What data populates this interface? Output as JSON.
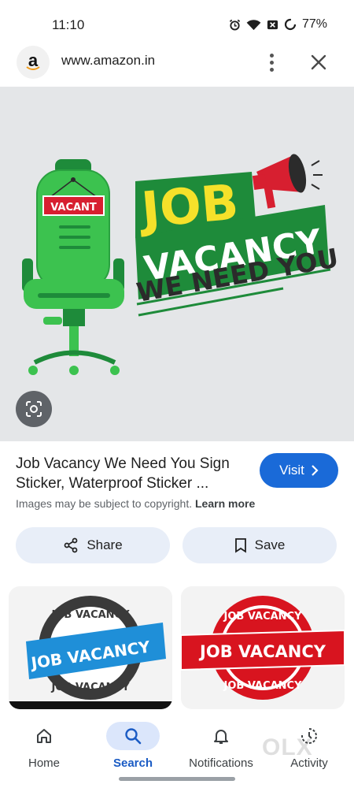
{
  "status_bar": {
    "time": "11:10",
    "battery": "77%",
    "icons": [
      "alarm-icon",
      "wifi-icon",
      "close-box-icon",
      "battery-ring-icon"
    ]
  },
  "browser": {
    "url": "www.amazon.in",
    "site_logo": "a",
    "menu_icon": "more-vert-icon",
    "close_icon": "close-icon"
  },
  "hero": {
    "vacant_sign": "VACANT",
    "headline_1": "JOB",
    "headline_2": "VACANCY",
    "headline_3": "WE NEED YOU",
    "colors": {
      "green": "#1e8b3a",
      "light_green": "#3cc24f",
      "yellow": "#f5e12a",
      "red": "#d71f30",
      "dark": "#2b2b2b",
      "background": "#e4e6e8"
    },
    "lens_icon": "lens-icon"
  },
  "result": {
    "title": "Job Vacancy We Need You Sign Sticker, Waterproof Sticker ...",
    "visit_label": "Visit",
    "copyright_text": "Images may be subject to copyright.",
    "learn_more": "Learn more",
    "share_label": "Share",
    "save_label": "Save",
    "accent": "#1a6ad8"
  },
  "thumbnails": [
    {
      "top_text": "JOB VACANCY",
      "banner_text": "JOB VACANCY",
      "bottom_text": "JOB VACANCY",
      "banner_color": "#1f8fd8"
    },
    {
      "top_text": "JOB VACANCY",
      "banner_text": "JOB VACANCY",
      "bottom_text": "JOB VACANCY",
      "banner_color": "#d8141f"
    }
  ],
  "bottom_nav": {
    "items": [
      {
        "label": "Home",
        "icon": "home-icon"
      },
      {
        "label": "Search",
        "icon": "search-icon",
        "active": true
      },
      {
        "label": "Notifications",
        "icon": "bell-icon"
      },
      {
        "label": "Activity",
        "icon": "activity-icon"
      }
    ],
    "watermark": "OLX"
  }
}
